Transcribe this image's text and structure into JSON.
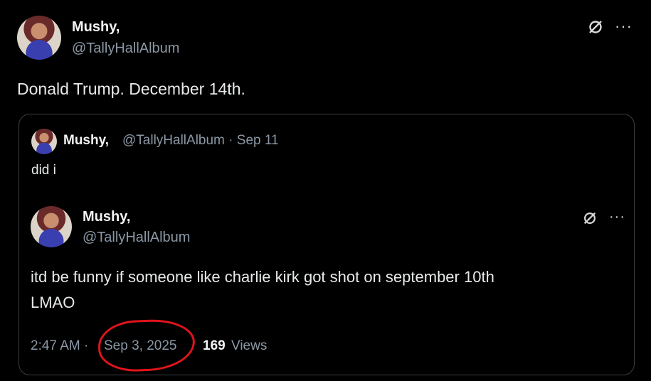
{
  "main_tweet": {
    "display_name": "Mushy,",
    "handle": "@TallyHallAlbum",
    "text": "Donald Trump. December 14th.",
    "more_icon": "more-icon",
    "grok_icon": "grok-icon"
  },
  "quoted_tweet": {
    "display_name": "Mushy,",
    "handle_and_date": "@TallyHallAlbum · Sep 11",
    "text": "did i"
  },
  "nested_tweet": {
    "display_name": "Mushy,",
    "handle": "@TallyHallAlbum",
    "text_line1": "itd be funny if someone like charlie kirk got shot on september 10th",
    "text_line2": "LMAO",
    "time": "2:47 AM ·",
    "date": "Sep 3, 2025",
    "views_count": "169",
    "views_label": "Views"
  },
  "colors": {
    "background": "#000000",
    "text": "#e7e9ea",
    "muted": "#8b98a5",
    "annotation_red": "#e0141b"
  }
}
